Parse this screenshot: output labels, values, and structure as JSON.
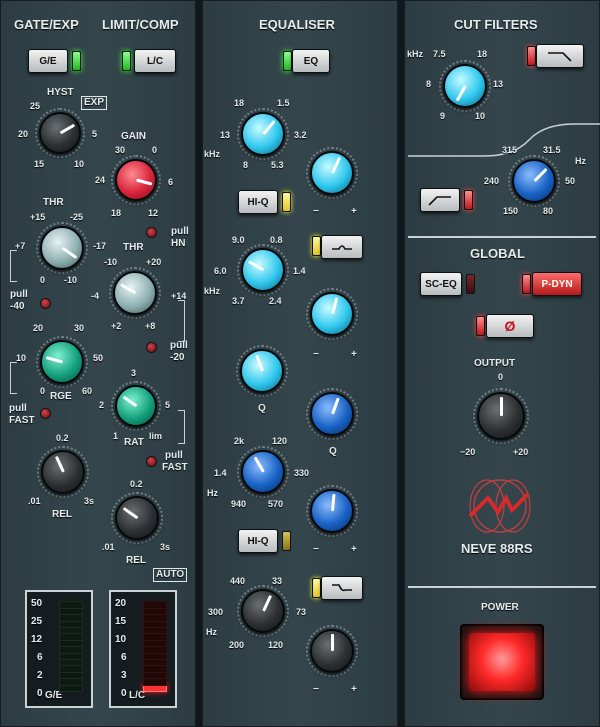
{
  "gate": {
    "title_ge": "GATE/EXP",
    "title_lc": "LIMIT/COMP",
    "ge_button": "G/E",
    "lc_button": "L/C",
    "hyst_label": "HYST",
    "exp_badge": "EXP",
    "hyst_scale": [
      "25",
      "20",
      "15",
      "10",
      "5"
    ],
    "gain_label": "GAIN",
    "gain_scale": [
      "30",
      "0",
      "24",
      "6",
      "18",
      "12"
    ],
    "thr1_label": "THR",
    "thr1_scale": [
      "+15",
      "-25",
      "+7",
      "-17",
      "0",
      "-10"
    ],
    "pull_hn": [
      "pull",
      "HN"
    ],
    "thr2_label": "THR",
    "thr2_scale": [
      "-10",
      "+20",
      "-4",
      "+14",
      "+2",
      "+8"
    ],
    "pull_40": [
      "pull",
      "-40"
    ],
    "pull_20": [
      "pull",
      "-20"
    ],
    "rge_label": "RGE",
    "rge_scale": [
      "20",
      "30",
      "10",
      "50",
      "0",
      "60"
    ],
    "rat_label": "RAT",
    "rat_scale": [
      "3",
      "2",
      "5",
      "1",
      "lim"
    ],
    "pull_fast_left": [
      "pull",
      "FAST"
    ],
    "pull_fast_right": [
      "pull",
      "FAST"
    ],
    "rel1_label": "REL",
    "rel1_scale": [
      "0.2",
      ".01",
      "3s"
    ],
    "rel2_label": "REL",
    "rel2_scale": [
      "0.2",
      ".01",
      "3s"
    ],
    "auto_badge": "AUTO"
  },
  "meters": {
    "ge_scale": [
      "50",
      "25",
      "12",
      "6",
      "2",
      "0"
    ],
    "ge_label": "G/E",
    "lc_scale": [
      "20",
      "15",
      "10",
      "6",
      "3",
      "0"
    ],
    "lc_label": "L/C",
    "lc_active_segment": "0"
  },
  "eq": {
    "title": "EQUALISER",
    "eq_button": "EQ",
    "b1_scale": [
      "18",
      "1.5",
      "13",
      "3.2",
      "kHz",
      "8",
      "5.3"
    ],
    "b2_scale": [
      "9.0",
      "0.8",
      "6.0",
      "1.4",
      "kHz",
      "3.7",
      "2.4"
    ],
    "b3_scale": [
      "2k",
      "120",
      "1.4",
      "330",
      "Hz",
      "940",
      "570"
    ],
    "b4_scale": [
      "440",
      "33",
      "300",
      "73",
      "Hz",
      "200",
      "120"
    ],
    "hiq_label_1": "HI-Q",
    "hiq_label_2": "HI-Q",
    "gain_minus": "−",
    "gain_plus": "+",
    "q_label": "Q",
    "bell_icon_1": "bell-shape-icon",
    "bell_icon_2": "lowshelf-shape-icon"
  },
  "cut": {
    "title": "CUT FILTERS",
    "lpf_scale": [
      "kHz",
      "7.5",
      "18",
      "8",
      "13",
      "9",
      "10"
    ],
    "hpf_scale": [
      "315",
      "31.5",
      "Hz",
      "240",
      "50",
      "150",
      "80"
    ]
  },
  "global": {
    "title": "GLOBAL",
    "sceq_button": "SC-EQ",
    "pdyn_button": "P-DYN",
    "phase_symbol": "Ø",
    "output_label": "OUTPUT",
    "output_scale": [
      "0",
      "−20",
      "+20"
    ],
    "brand": "NEVE 88RS",
    "power_label": "POWER"
  }
}
